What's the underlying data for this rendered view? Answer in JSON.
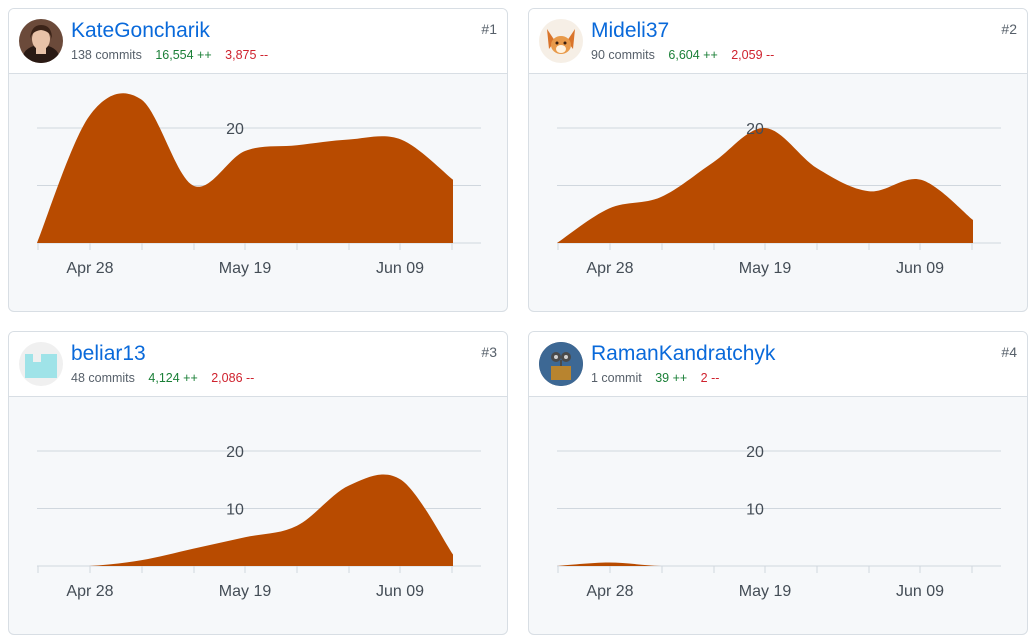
{
  "colors": {
    "area": "#b84b00",
    "link": "#0969da",
    "additions": "#1a7f37",
    "deletions": "#cf222e"
  },
  "contributors": [
    {
      "rank": "#1",
      "name": "KateGoncharik",
      "commits": "138 commits",
      "additions": "16,554 ++",
      "deletions": "3,875 --",
      "avatar": "portrait-woman",
      "chart_data": {
        "type": "area",
        "x": [
          "2024-04-21",
          "2024-04-28",
          "2024-05-05",
          "2024-05-12",
          "2024-05-19",
          "2024-05-26",
          "2024-06-02",
          "2024-06-09",
          "2024-06-16"
        ],
        "y": [
          0,
          22,
          25,
          10,
          16,
          17,
          18,
          18,
          11
        ],
        "x_tick_labels": [
          "Apr 28",
          "May 19",
          "Jun 09"
        ],
        "y_tick_labels": [
          "20"
        ],
        "y_ticks": [
          10,
          20
        ],
        "ylim": [
          0,
          20
        ],
        "grid": true
      }
    },
    {
      "rank": "#2",
      "name": "Mideli37",
      "commits": "90 commits",
      "additions": "6,604 ++",
      "deletions": "2,059 --",
      "avatar": "fox-character",
      "chart_data": {
        "type": "area",
        "x": [
          "2024-04-21",
          "2024-04-28",
          "2024-05-05",
          "2024-05-12",
          "2024-05-19",
          "2024-05-26",
          "2024-06-02",
          "2024-06-09",
          "2024-06-16"
        ],
        "y": [
          0,
          6,
          8,
          14,
          20,
          13,
          9,
          11,
          4
        ],
        "x_tick_labels": [
          "Apr 28",
          "May 19",
          "Jun 09"
        ],
        "y_tick_labels": [
          "20"
        ],
        "y_ticks": [
          10,
          20
        ],
        "ylim": [
          0,
          20
        ],
        "grid": true
      }
    },
    {
      "rank": "#3",
      "name": "beliar13",
      "commits": "48 commits",
      "additions": "4,124 ++",
      "deletions": "2,086 --",
      "avatar": "identicon",
      "chart_data": {
        "type": "area",
        "x": [
          "2024-04-21",
          "2024-04-28",
          "2024-05-05",
          "2024-05-12",
          "2024-05-19",
          "2024-05-26",
          "2024-06-02",
          "2024-06-09",
          "2024-06-16"
        ],
        "y": [
          0,
          0,
          1,
          3,
          5,
          7,
          14,
          15,
          2
        ],
        "x_tick_labels": [
          "Apr 28",
          "May 19",
          "Jun 09"
        ],
        "y_tick_labels": [
          "20",
          "10"
        ],
        "y_ticks": [
          10,
          20
        ],
        "ylim": [
          0,
          20
        ],
        "grid": true
      }
    },
    {
      "rank": "#4",
      "name": "RamanKandratchyk",
      "commits": "1 commit",
      "additions": "39 ++",
      "deletions": "2 --",
      "avatar": "robot-character",
      "chart_data": {
        "type": "area",
        "x": [
          "2024-04-21",
          "2024-04-28",
          "2024-05-05",
          "2024-05-12",
          "2024-05-19",
          "2024-05-26",
          "2024-06-02",
          "2024-06-09",
          "2024-06-16"
        ],
        "y": [
          0,
          0.6,
          0,
          0,
          0,
          0,
          0,
          0,
          0
        ],
        "x_tick_labels": [
          "Apr 28",
          "May 19",
          "Jun 09"
        ],
        "y_tick_labels": [
          "20",
          "10"
        ],
        "y_ticks": [
          10,
          20
        ],
        "ylim": [
          0,
          20
        ],
        "grid": true
      }
    }
  ]
}
